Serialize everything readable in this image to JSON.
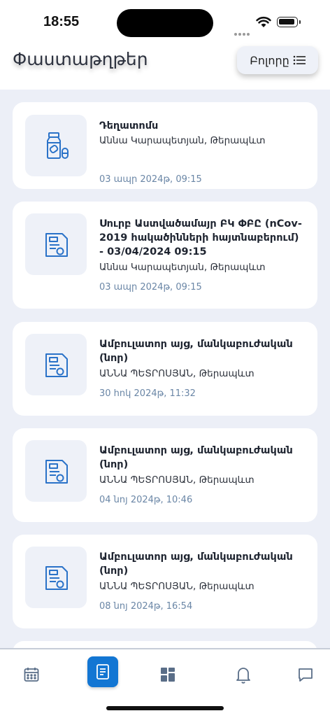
{
  "status_bar": {
    "time": "18:55"
  },
  "header": {
    "title": "Փաստաթղթեր",
    "filter_label": "Բոլորը"
  },
  "documents": [
    {
      "title": "Դեղատոմս",
      "doctor": "Աննա Կարապետյան, Թերապևտ",
      "date": "03 ապր 2024թ, 09:15",
      "icon": "medicine-bottle-icon"
    },
    {
      "title": "Սուրբ Աստվածամայր ԲԿ ՓԲԸ (nCov-2019 հակածինների հայտնաբերում) - 03/04/2024 09:15",
      "doctor": "Աննա Կարապետյան, Թերապևտ",
      "date": "03 ապր 2024թ, 09:15",
      "icon": "medical-document-icon"
    },
    {
      "title": "Ամբուլատոր այց, մանկաբուժական (նոր)",
      "doctor": "ԱՆՆԱ ՊԵՏՐՈՍՅԱՆ, Թերապևտ",
      "date": "30 հոկ 2024թ, 11:32",
      "icon": "medical-document-icon"
    },
    {
      "title": "Ամբուլատոր այց, մանկաբուժական (նոր)",
      "doctor": "ԱՆՆԱ ՊԵՏՐՈՍՅԱՆ, Թերապևտ",
      "date": "04 նոյ 2024թ, 10:46",
      "icon": "medical-document-icon"
    },
    {
      "title": "Ամբուլատոր այց, մանկաբուժական (նոր)",
      "doctor": "ԱՆՆԱ ՊԵՏՐՈՍՅԱՆ, Թերապևտ",
      "date": "08 նոյ 2024թ, 16:54",
      "icon": "medical-document-icon"
    }
  ],
  "tab_bar": {
    "tabs": [
      {
        "icon": "calendar-icon",
        "active": false
      },
      {
        "icon": "document-icon",
        "active": true
      },
      {
        "icon": "dashboard-icon",
        "active": false
      },
      {
        "icon": "bell-icon",
        "active": false
      },
      {
        "icon": "chat-icon",
        "active": false
      }
    ]
  },
  "colors": {
    "accent": "#1376d3",
    "background": "#eceff7",
    "date_text": "#6a86a6",
    "icon_blue": "#2a72c8"
  }
}
